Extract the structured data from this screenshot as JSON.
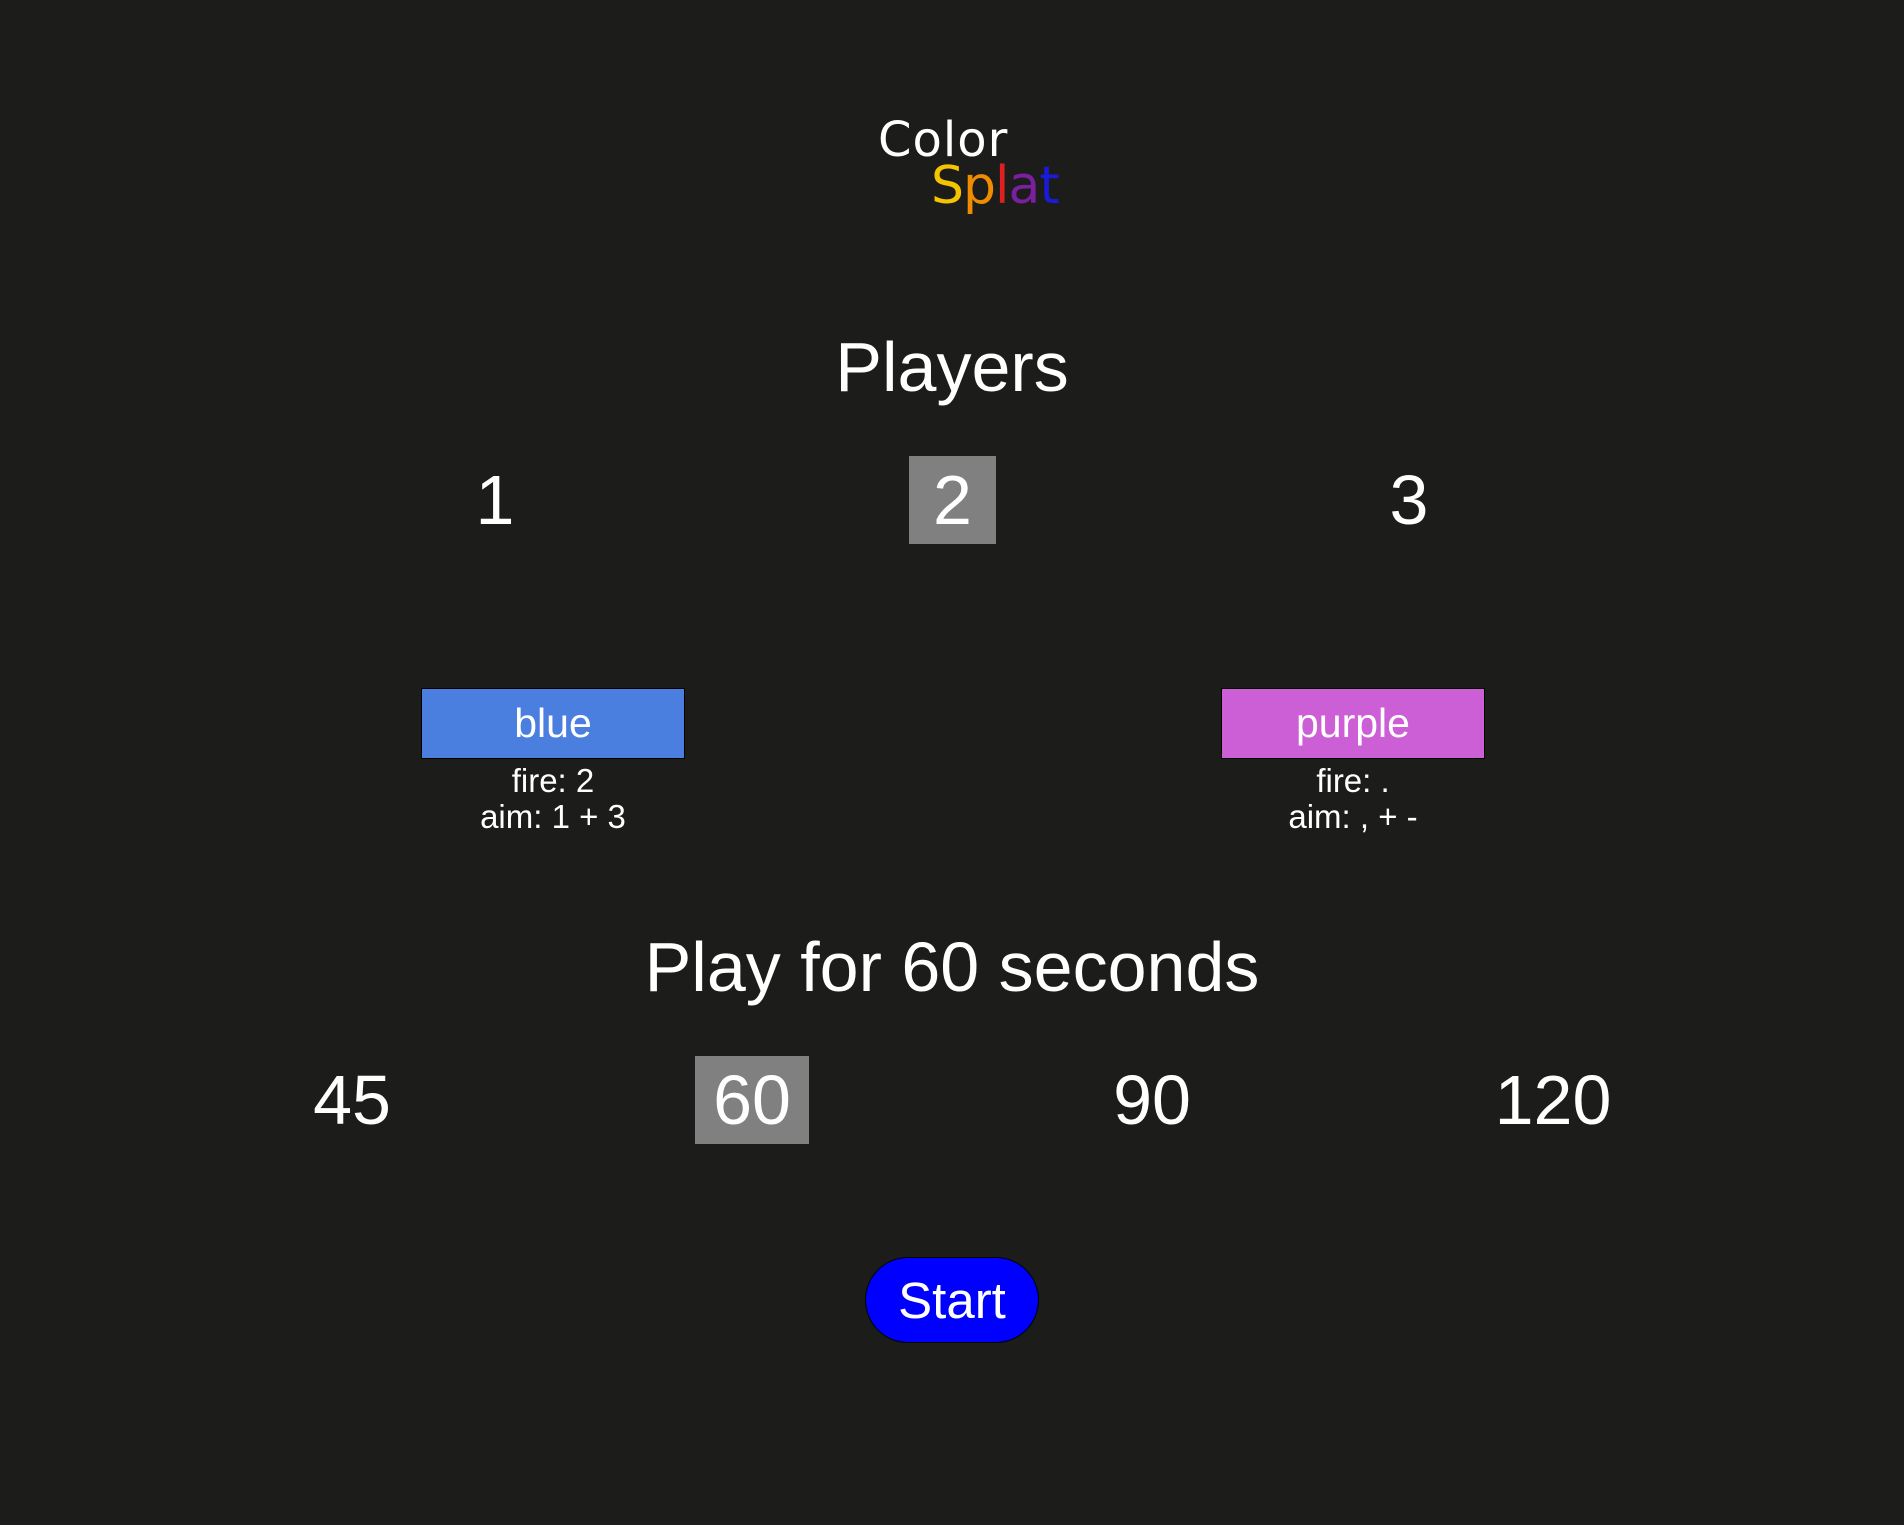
{
  "logo": {
    "word1": "Color",
    "letters": [
      {
        "char": "S",
        "color": "#f5c400"
      },
      {
        "char": "p",
        "color": "#f08c00"
      },
      {
        "char": "l",
        "color": "#e02020"
      },
      {
        "char": "a",
        "color": "#7a1fa0"
      },
      {
        "char": "t",
        "color": "#1a1ad8"
      }
    ]
  },
  "players": {
    "title": "Players",
    "options": [
      "1",
      "2",
      "3"
    ],
    "selected": "2"
  },
  "player_cards": [
    {
      "color_name": "blue",
      "color": "#4a7fe0",
      "fire": "fire: 2",
      "aim": "aim: 1 + 3"
    },
    {
      "color_name": "purple",
      "color": "#cc5fd6",
      "fire": "fire: .",
      "aim": "aim: , + -"
    }
  ],
  "duration": {
    "title": "Play for 60 seconds",
    "options": [
      "45",
      "60",
      "90",
      "120"
    ],
    "selected": "60"
  },
  "start": {
    "label": "Start",
    "color": "#0000ff"
  },
  "colors": {
    "background": "#1c1d1b",
    "selected_option": "#808080"
  }
}
